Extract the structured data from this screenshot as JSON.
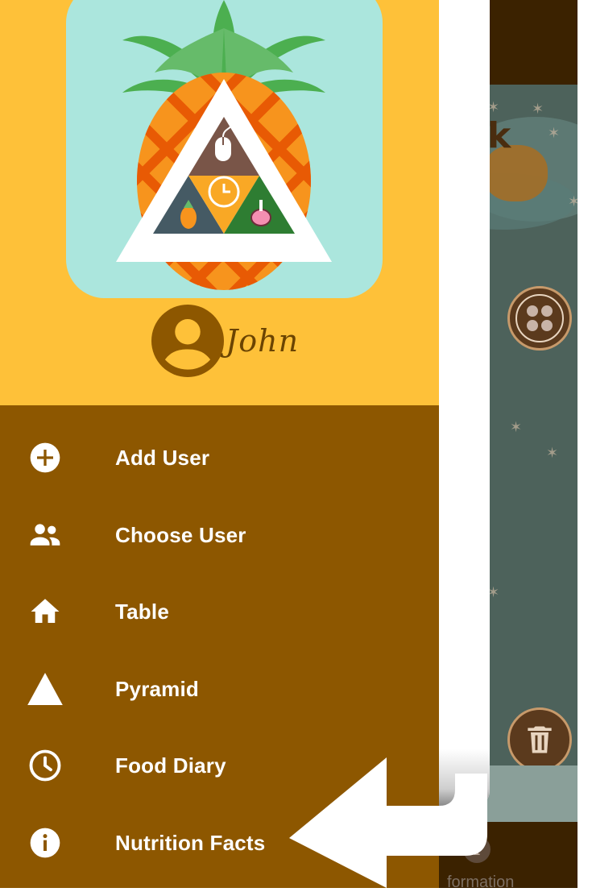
{
  "drawer": {
    "header": {
      "logo": "pineapple-pyramid-logo",
      "username": "John"
    },
    "items": [
      {
        "icon": "add-circle-icon",
        "label": "Add User"
      },
      {
        "icon": "people-icon",
        "label": "Choose User"
      },
      {
        "icon": "home-icon",
        "label": "Table"
      },
      {
        "icon": "triangle-icon",
        "label": "Pyramid"
      },
      {
        "icon": "clock-icon",
        "label": "Food Diary"
      },
      {
        "icon": "info-icon",
        "label": "Nutrition Facts"
      }
    ]
  },
  "background": {
    "bottom_tab_label": "formation",
    "heading_fragment": "k"
  },
  "colors": {
    "header_yellow": "#fec139",
    "menu_brown": "#8d5700",
    "topbar_dark": "#3b2200",
    "logo_mint": "#abe6dd",
    "avatar_brown": "#8d5700"
  }
}
